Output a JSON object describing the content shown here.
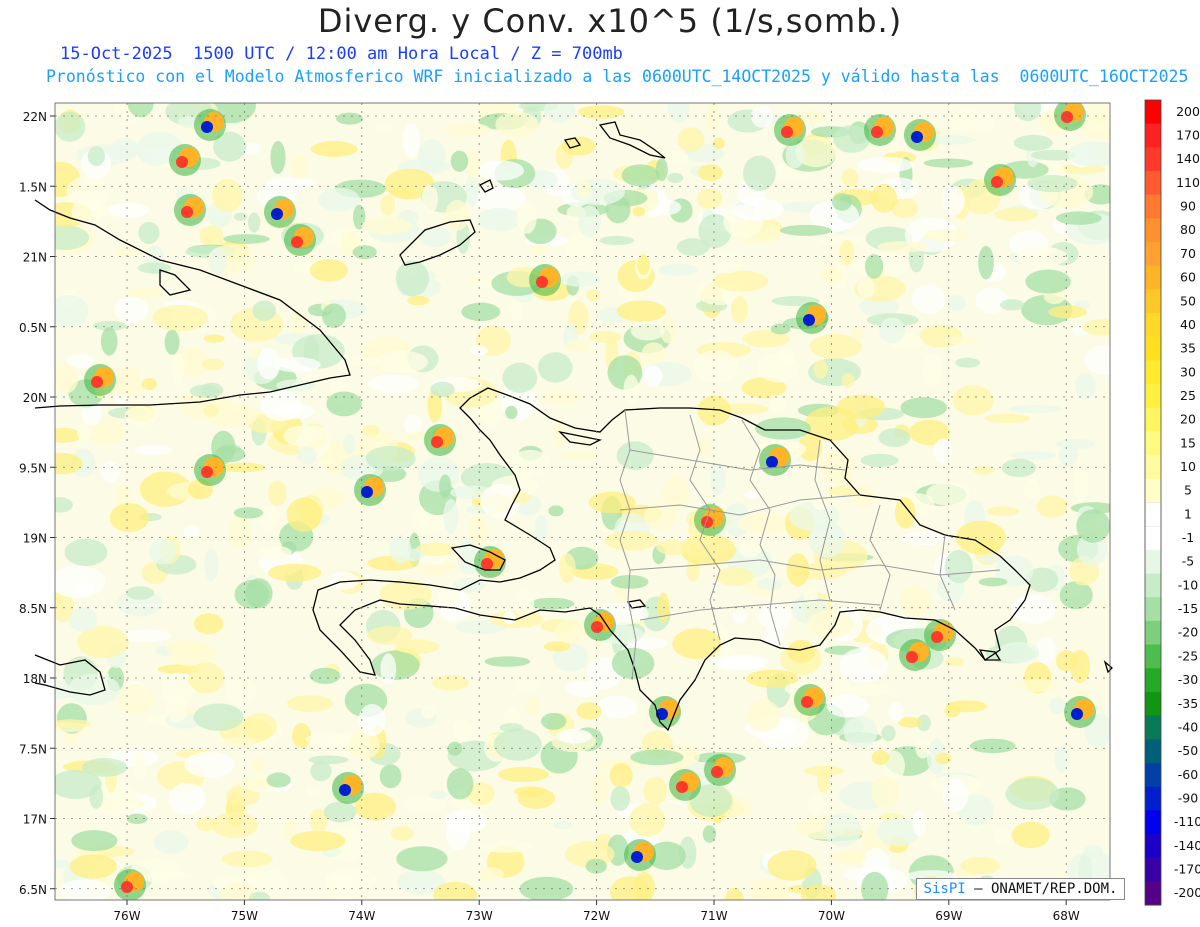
{
  "title": "Diverg. y Conv. x10^5 (1/s,somb.)",
  "subtitle_line1": "15-Oct-2025  1500 UTC / 12:00 am Hora Local / Z = 700mb",
  "subtitle_line2": "Pronóstico con el Modelo Atmosferico WRF inicializado a las 0600UTC_14OCT2025 y válido hasta las  0600UTC_16OCT2025",
  "credit": {
    "brand": "SisPI",
    "text": "– ONAMET/REP.DOM."
  },
  "map": {
    "lat_labels": [
      "22N",
      "1.5N",
      "21N",
      "0.5N",
      "20N",
      "9.5N",
      "19N",
      "8.5N",
      "18N",
      "7.5N",
      "17N",
      "6.5N"
    ],
    "lon_labels": [
      "76W",
      "75W",
      "74W",
      "73W",
      "72W",
      "71W",
      "70W",
      "69W",
      "68W"
    ],
    "lat_values": [
      22,
      21.5,
      21,
      20.5,
      20,
      19.5,
      19,
      18.5,
      18,
      17.5,
      17,
      16.5
    ],
    "lon_values": [
      -76,
      -75,
      -74,
      -73,
      -72,
      -71,
      -70,
      -69,
      -68
    ],
    "colors": {
      "coastline": "#000000",
      "provinces": "#999999",
      "grid": "#777777"
    }
  },
  "colorbar": {
    "labels": [
      "200",
      "170",
      "140",
      "110",
      "90",
      "80",
      "70",
      "60",
      "50",
      "40",
      "35",
      "30",
      "25",
      "20",
      "15",
      "10",
      "5",
      "1",
      "-1",
      "-5",
      "-10",
      "-15",
      "-20",
      "-25",
      "-30",
      "-35",
      "-40",
      "-50",
      "-60",
      "-90",
      "-110",
      "-140",
      "-170",
      "-200"
    ],
    "colors": [
      "#ff0000",
      "#ff2020",
      "#ff3a2a",
      "#ff5a30",
      "#ff7a30",
      "#ff9030",
      "#ffa030",
      "#ffb428",
      "#ffc828",
      "#ffd828",
      "#ffe020",
      "#ffea30",
      "#fff040",
      "#fff560",
      "#fffa80",
      "#fffca0",
      "#fffec8",
      "#ffffff",
      "#ffffff",
      "#e6f7e6",
      "#c8ecc8",
      "#a6dfa6",
      "#7ccf7c",
      "#4dbd4d",
      "#26aa26",
      "#129612",
      "#0a7a56",
      "#00607a",
      "#0040a8",
      "#0020d0",
      "#0000ee",
      "#1a00c8",
      "#3a00a8",
      "#550088"
    ]
  }
}
